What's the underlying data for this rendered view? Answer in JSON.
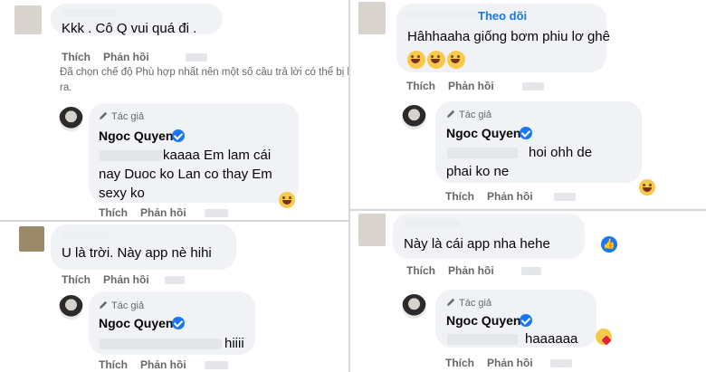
{
  "strings": {
    "like": "Thích",
    "reply": "Phản hồi",
    "author": "Tác giả",
    "author_name": "Ngoc Quyen",
    "follow": "Theo dõi"
  },
  "comments": {
    "tl_main": "Kkk . Cô Q vui quá đi .",
    "tl_note": "Đã chọn chế độ Phù hợp nhất nên một số câu trả lời có thể bị lọc ra.",
    "tl_reply_l1": "kaaaa Em lam cái",
    "tl_reply_l2": "nay Duoc ko Lan co thay Em",
    "tl_reply_l3": "sexy ko",
    "bl_main": "U là trời. Này app nè hihi",
    "bl_reply": "hiiii",
    "tr_main": "Hâhhaaha giống bơm phiu lơ ghê",
    "tr_reply_l1": "hoi ohh de",
    "tr_reply_l2": "phai ko ne",
    "br_main": "Này là cái app nha hehe",
    "br_reply": "haaaaaa"
  },
  "icons": {
    "laugh": "laugh-emoji-icon",
    "like": "like-reaction-icon",
    "love": "care-reaction-icon",
    "verified": "verified-badge-icon",
    "pen": "pen-icon"
  },
  "colors": {
    "accent": "#1877f2",
    "bubble": "#f0f2f5",
    "secondary_text": "#65676b"
  }
}
